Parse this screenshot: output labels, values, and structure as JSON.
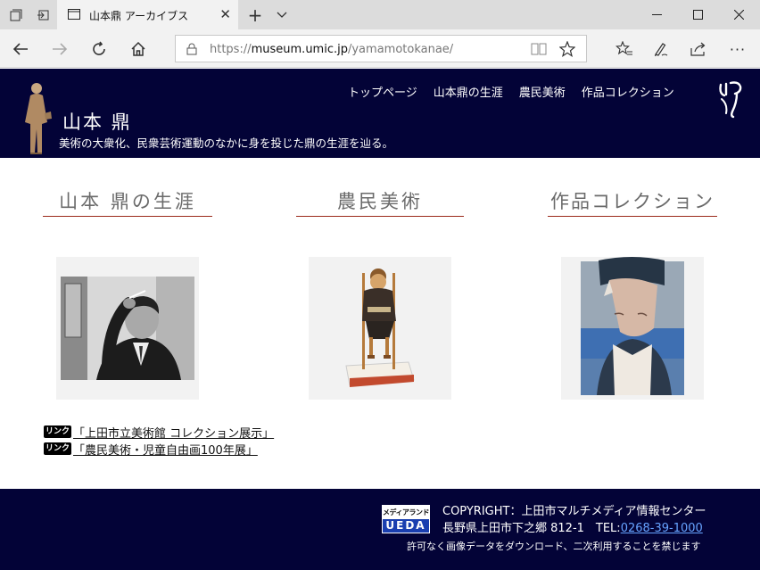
{
  "browser": {
    "tab_title": "山本鼎 アーカイブス",
    "url_prefix": "https://",
    "url_host": "museum.umic.jp",
    "url_path": "/yamamotokanae/"
  },
  "header": {
    "title": "山本 鼎",
    "tagline": "美術の大衆化、民衆芸術運動のなかに身を投じた鼎の生涯を辿る。",
    "menu": [
      "トップページ",
      "山本鼎の生涯",
      "農民美術",
      "作品コレクション"
    ]
  },
  "sections": [
    {
      "heading": "山本 鼎の生涯"
    },
    {
      "heading": "農民美術"
    },
    {
      "heading": "作品コレクション"
    }
  ],
  "links": [
    {
      "badge": "リンク",
      "text": "「上田市立美術館 コレクション展示」"
    },
    {
      "badge": "リンク",
      "text": "「農民美術・児童自由画100年展」"
    }
  ],
  "footer": {
    "logo_top": "メディアランド",
    "logo_bottom": "UEDA",
    "copyright": "COPYRIGHT：上田市マルチメディア情報センター",
    "address": "長野県上田市下之郷 812-1　TEL:",
    "tel": "0268-39-1000",
    "notice": "許可なく画像データをダウンロード、二次利用することを禁じます"
  }
}
